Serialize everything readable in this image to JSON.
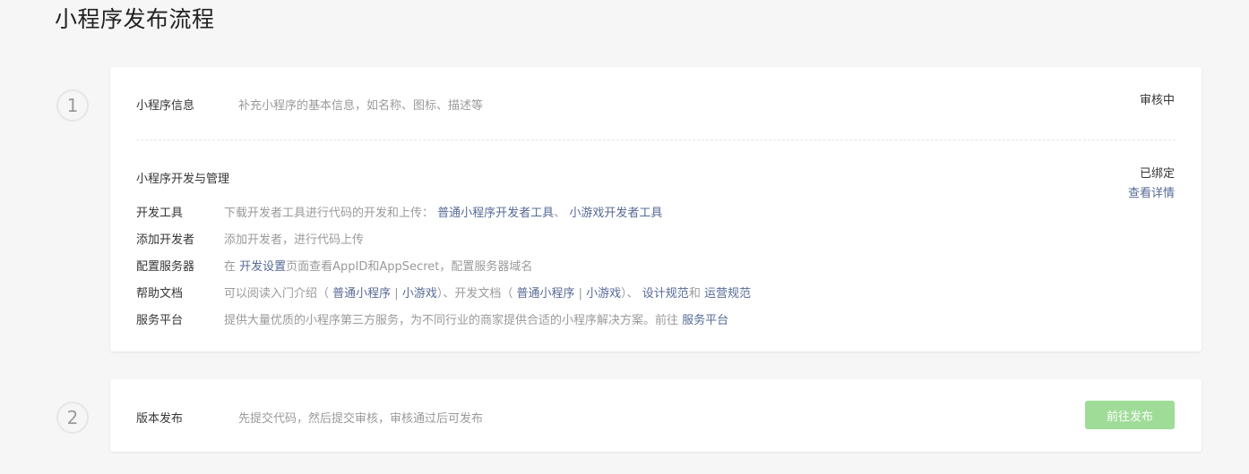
{
  "page_title": "小程序发布流程",
  "steps": [
    {
      "number": "1",
      "info": {
        "label": "小程序信息",
        "desc": "补充小程序的基本信息，如名称、图标、描述等",
        "status": "审核中"
      },
      "dev": {
        "title": "小程序开发与管理",
        "status": "已绑定",
        "detail_link": "查看详情",
        "rows": {
          "tools": {
            "key": "开发工具",
            "text": "下载开发者工具进行代码的开发和上传：",
            "link1": "普通小程序开发者工具",
            "sep": "、 ",
            "link2": "小游戏开发者工具"
          },
          "add_dev": {
            "key": "添加开发者",
            "text": "添加开发者，进行代码上传"
          },
          "server": {
            "key": "配置服务器",
            "prefix": "在 ",
            "link": "开发设置",
            "suffix": "页面查看AppID和AppSecret，配置服务器域名"
          },
          "docs": {
            "key": "帮助文档",
            "t1": "可以阅读入门介绍（ ",
            "l1": "普通小程序",
            "bar1": " | ",
            "l2": "小游戏",
            "t2": "）、开发文档（ ",
            "l3": "普通小程序",
            "bar2": " | ",
            "l4": "小游戏",
            "t3": "）、 ",
            "l5": "设计规范",
            "t4": "和 ",
            "l6": "运营规范"
          },
          "platform": {
            "key": "服务平台",
            "text": "提供大量优质的小程序第三方服务，为不同行业的商家提供合适的小程序解决方案。前往 ",
            "link": "服务平台"
          }
        }
      }
    },
    {
      "number": "2",
      "label": "版本发布",
      "desc": "先提交代码，然后提交审核，审核通过后可发布",
      "button": "前往发布"
    }
  ],
  "colors": {
    "link": "#576b95",
    "button_disabled": "#9fdc98",
    "background": "#f6f6f6"
  }
}
